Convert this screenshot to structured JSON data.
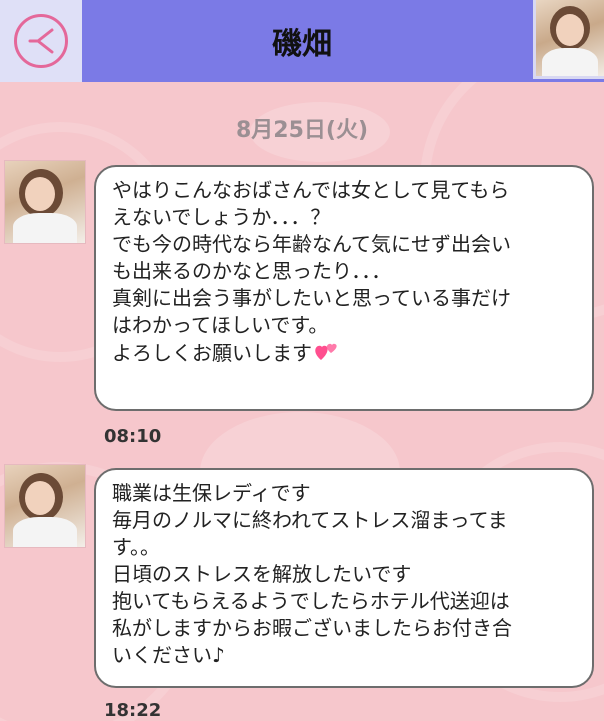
{
  "header": {
    "title": "磯畑",
    "back_icon": "back-arrow-icon",
    "accent": "#7b7ae6"
  },
  "date_label": "8月25日(火)",
  "messages": [
    {
      "text": "やはりこんなおばさんでは女として見てもら\nえないでしょうか．．．？\nでも今の時代なら年齢なんて気にせず出会い\nも出来るのかなと思ったり．．．\n真剣に出会う事がしたいと思っている事だけ\nはわかってほしいです。\nよろしくお願いします",
      "emoji": "two-hearts-icon",
      "time": "08:10"
    },
    {
      "text": "職業は生保レディです\n毎月のノルマに終われてストレス溜まってま\nす。。\n日頃のストレスを解放したいです\n抱いてもらえるようでしたらホテル代送迎は\n私がしますからお暇ございましたらお付き合\nいください♪",
      "time": "18:22"
    }
  ]
}
